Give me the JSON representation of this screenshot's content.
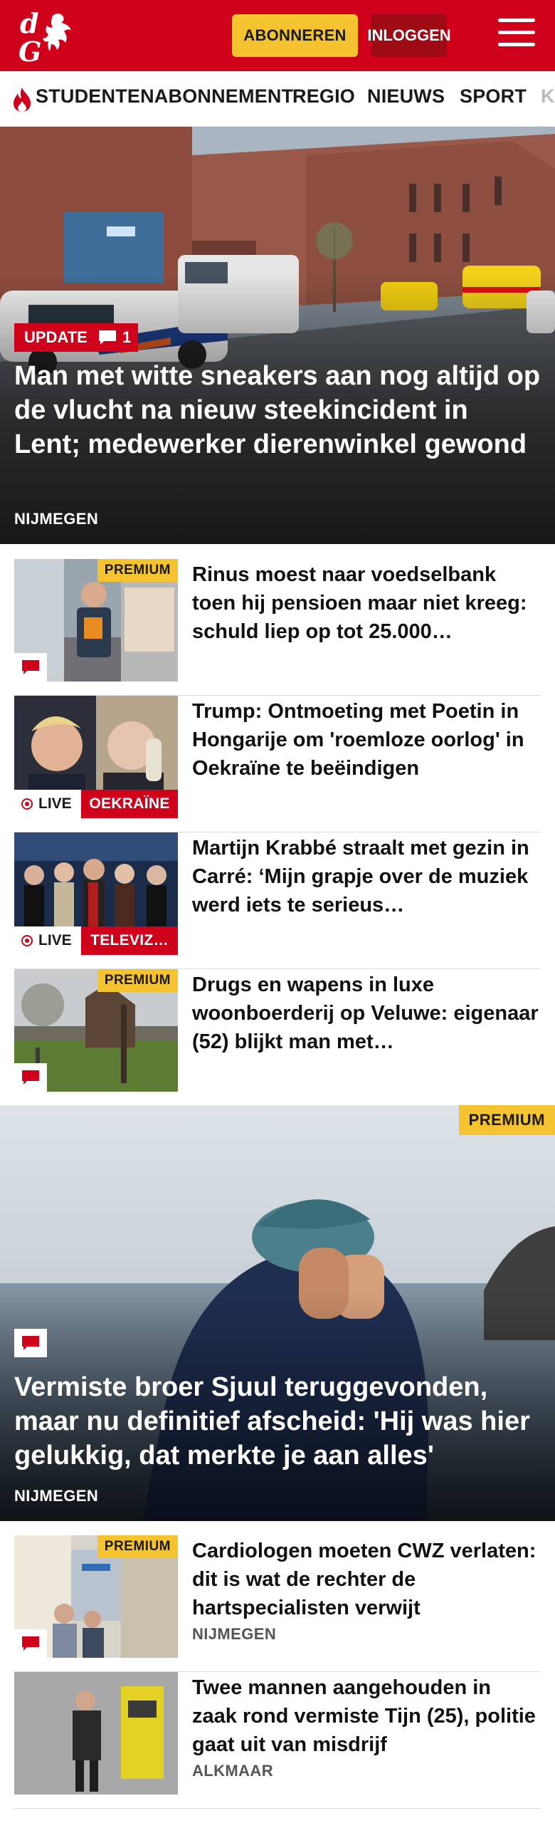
{
  "header": {
    "subscribe_label": "ABONNEREN",
    "login_label": "INLOGGEN",
    "brand_color": "#d0021b"
  },
  "nav": {
    "items": [
      {
        "label": "STUDENTENABONNEMENT",
        "icon": "flame-icon"
      },
      {
        "label": "REGIO"
      },
      {
        "label": "NIEUWS"
      },
      {
        "label": "SPORT"
      },
      {
        "label": "K"
      }
    ]
  },
  "hero": {
    "badge": "UPDATE",
    "comments": "1",
    "title": "Man met witte sneakers aan nog altijd op de vlucht na nieuw steekincident in Lent; medewerker dierenwinkel gewond",
    "place": "NIJMEGEN"
  },
  "articles": [
    {
      "title": "Rinus moest naar voedselbank toen hij pensioen maar niet kreeg: schuld liep op tot 25.000…",
      "premium": "PREMIUM"
    },
    {
      "title": "Trump: Ontmoeting met Poetin in Hongarije om 'roemloze oorlog' in Oekraïne te beëindigen",
      "live": "LIVE",
      "tag": "OEKRAÏNE"
    },
    {
      "title": "Martijn Krabbé straalt met gezin in Carré: ‘Mijn grapje over de muziek werd iets te serieus…",
      "live": "LIVE",
      "tag": "TELEVIZ…"
    },
    {
      "title": "Drugs en wapens in luxe woonboerderij op Veluwe: eigenaar (52) blijkt man met…",
      "premium": "PREMIUM"
    }
  ],
  "feature": {
    "premium": "PREMIUM",
    "title": "Vermiste broer Sjuul teruggevonden, maar nu definitief afscheid: 'Hij was hier gelukkig, dat merkte je aan alles'",
    "place": "NIJMEGEN"
  },
  "articles2": [
    {
      "title": "Cardiologen moeten CWZ verlaten: dit is wat de rechter de hartspecialisten verwijt",
      "place": "NIJMEGEN",
      "premium": "PREMIUM"
    },
    {
      "title": "Twee mannen aangehouden in zaak rond vermiste Tijn (25), politie gaat uit van misdrijf",
      "place": "ALKMAAR"
    }
  ]
}
